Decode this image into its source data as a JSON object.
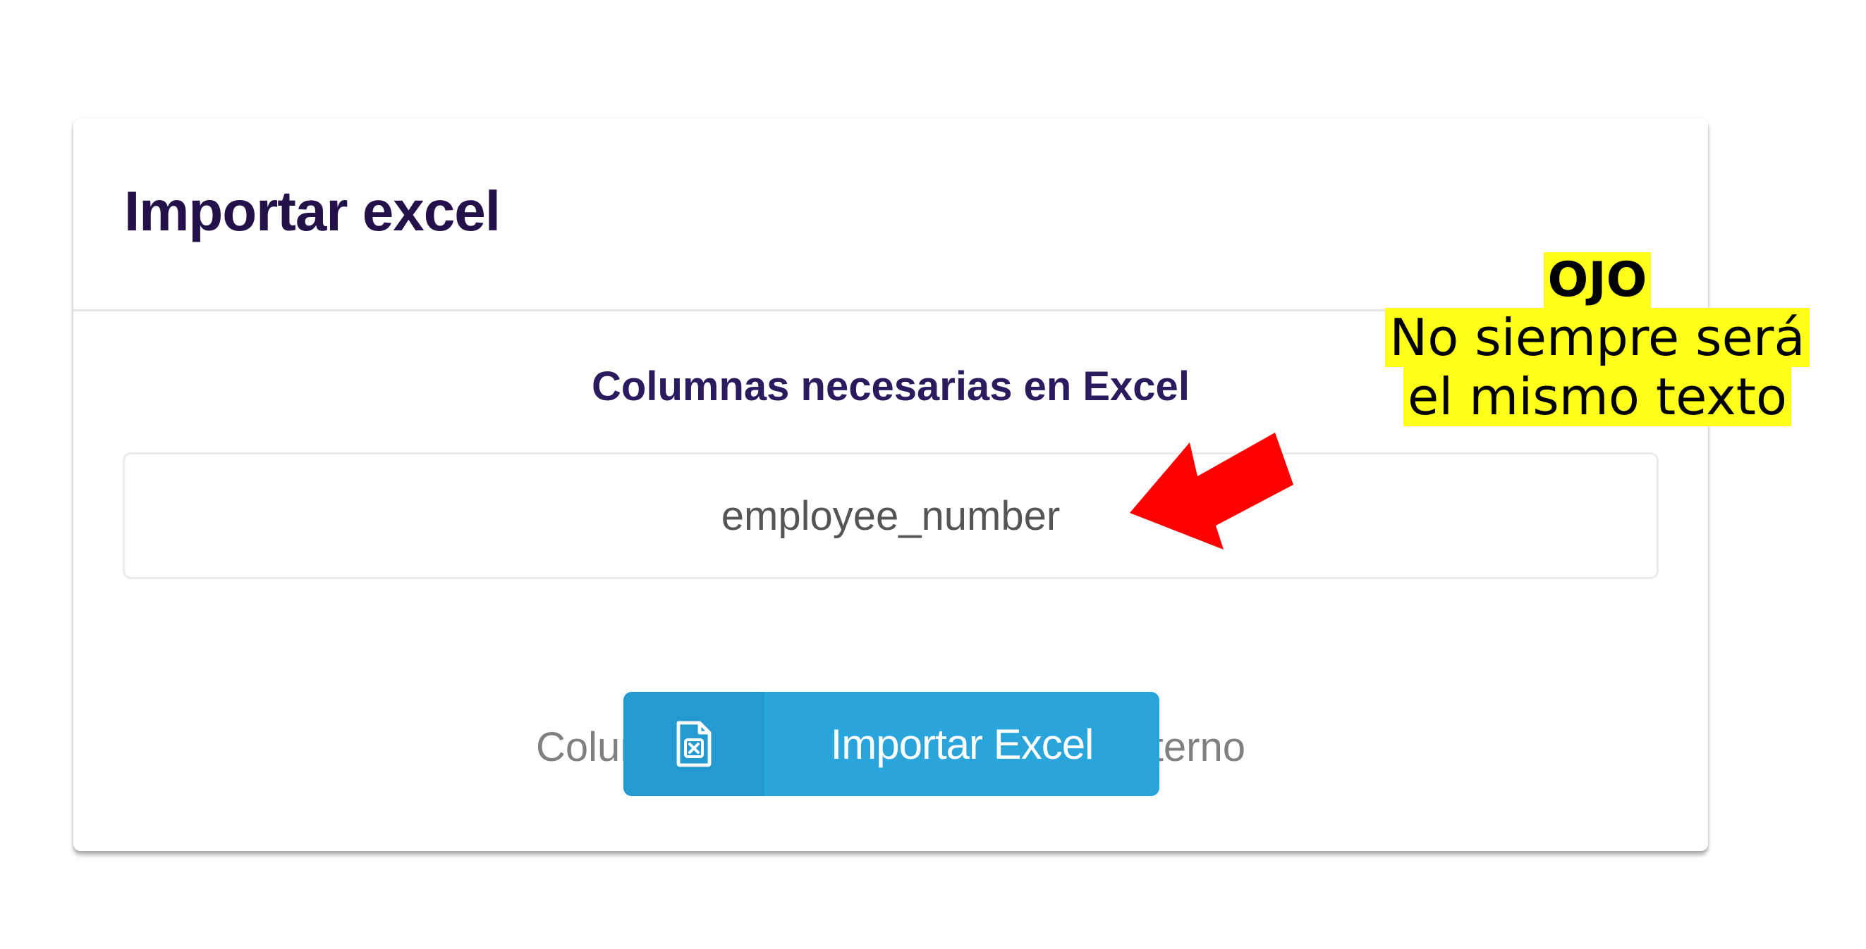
{
  "dialog": {
    "title": "Importar excel",
    "required_heading": "Columnas necesarias en Excel",
    "required_columns": "employee_number",
    "optional_text": "Columnas opcionales, para uso interno",
    "import_button": {
      "label": "Importar Excel",
      "icon": "file-excel-icon"
    }
  },
  "annotation": {
    "title": "OJO",
    "line1": "No siempre será",
    "line2": "el mismo texto",
    "highlight_color": "#ffff1a",
    "arrow_color": "#ff0000"
  },
  "colors": {
    "title": "#23124a",
    "button": "#2aa5dc",
    "button_icon_bg": "#259ad0"
  }
}
